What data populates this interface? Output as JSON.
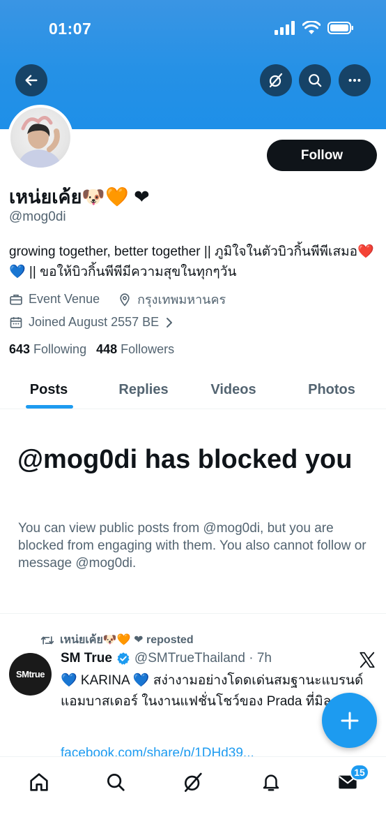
{
  "status_bar": {
    "time": "01:07"
  },
  "colors": {
    "accent": "#1d9bf0",
    "banner": "#2591e6",
    "text": "#0f1419",
    "secondary": "#536471"
  },
  "header": {
    "back_icon": "arrow-left-icon",
    "grok_icon": "grok-icon",
    "search_icon": "search-icon",
    "more_icon": "more-icon"
  },
  "profile": {
    "display_name": "เหน่ยเค้ย🐶🧡 ❤",
    "handle": "@mog0di",
    "follow_label": "Follow",
    "bio": "growing together, better together || ภูมิใจในตัวบิวกิ้นพีพีเสมอ❤️💙 || ขอให้บิวกิ้นพีพีมีความสุขในทุกๆวัน",
    "category": "Event Venue",
    "location": "กรุงเทพมหานคร",
    "joined": "Joined August 2557 BE",
    "following_count": "643",
    "following_label": "Following",
    "followers_count": "448",
    "followers_label": "Followers"
  },
  "tabs": [
    {
      "label": "Posts",
      "active": true
    },
    {
      "label": "Replies",
      "active": false
    },
    {
      "label": "Videos",
      "active": false
    },
    {
      "label": "Photos",
      "active": false
    }
  ],
  "blocked": {
    "title": "@mog0di has blocked you",
    "description": "You can view public posts from @mog0di, but you are blocked from engaging with them. You also cannot follow or message @mog0di."
  },
  "post": {
    "repost_label": "เหน่ยเค้ย🐶🧡 ❤ reposted",
    "avatar_text": "SMtrue",
    "author": "SM True",
    "handle_time": "@SMTrueThailand · 7h",
    "text": "💙 KARINA 💙 สง่างามอย่างโดดเด่นสมฐานะแบรนด์แอมบาสเดอร์ ในงานแฟชั่นโชว์ของ Prada ที่มิลาน !",
    "link": "facebook.com/share/p/1DHd39..."
  },
  "bottom_nav": {
    "items": [
      "home-icon",
      "search-icon",
      "grok-icon",
      "notifications-icon",
      "messages-icon"
    ],
    "messages_badge": "15"
  }
}
